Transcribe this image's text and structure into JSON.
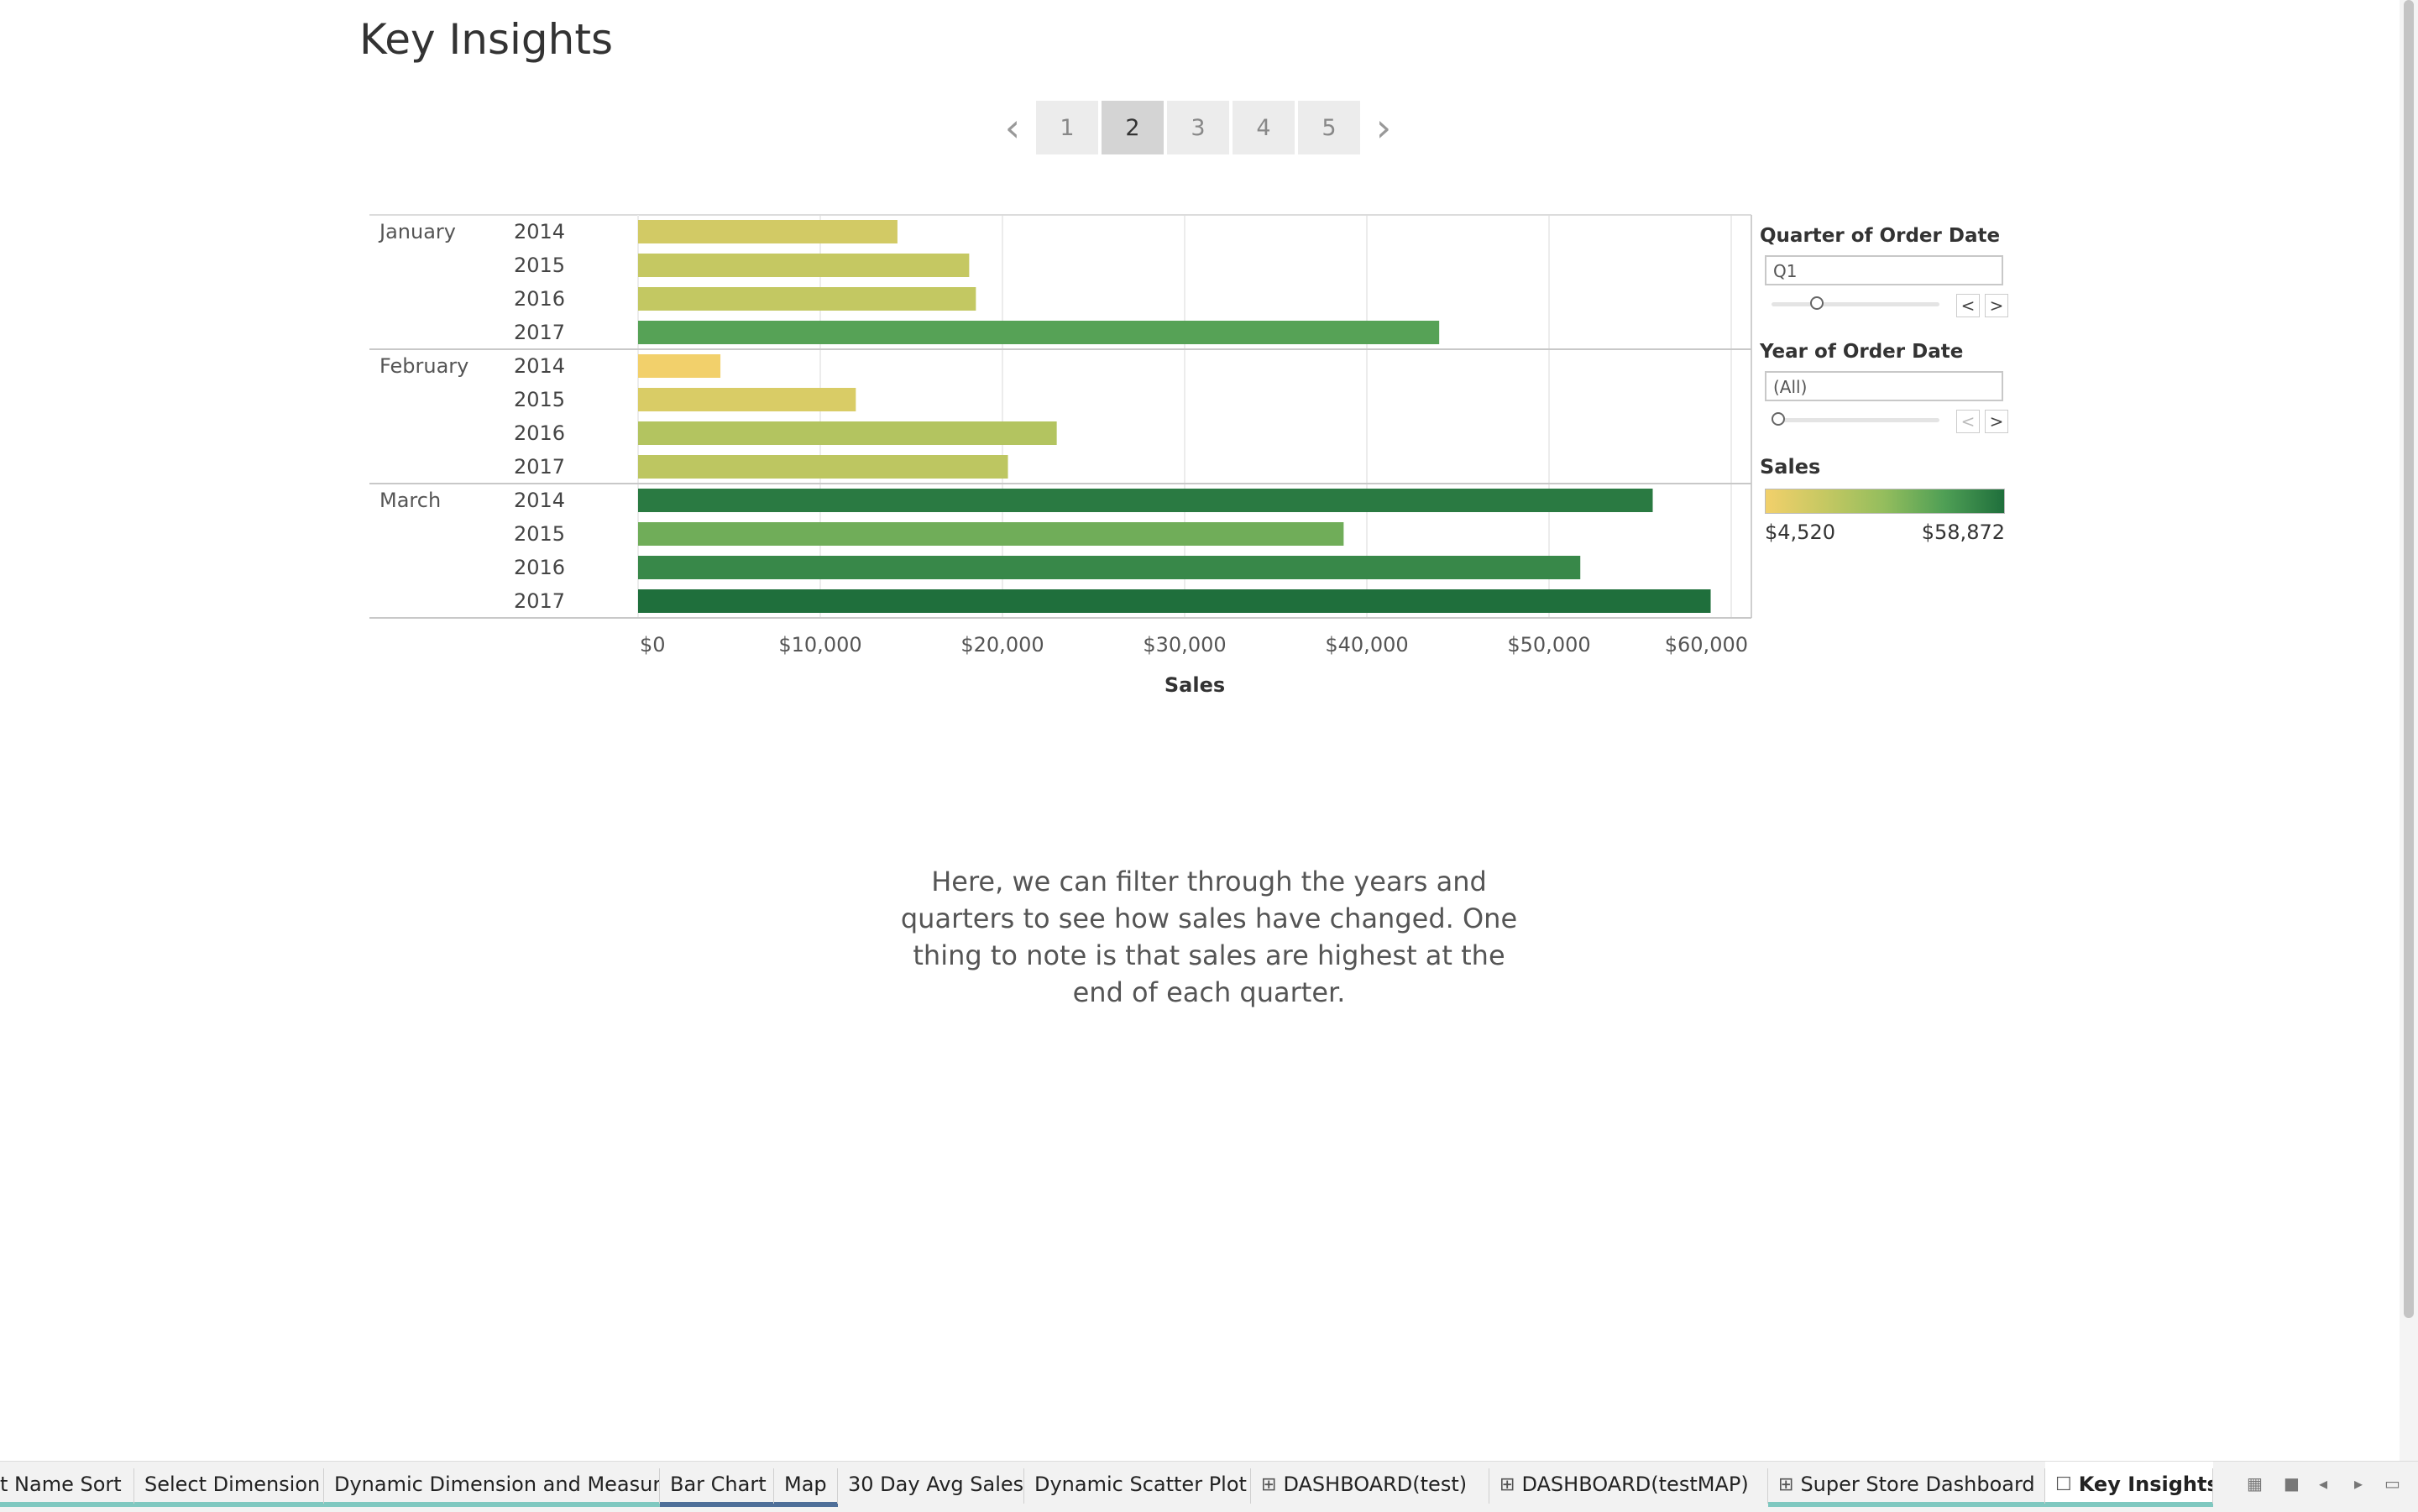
{
  "story": {
    "title": "Key Insights",
    "pages": [
      "1",
      "2",
      "3",
      "4",
      "5"
    ],
    "active_page": "2",
    "prev_icon": "chevron-left-icon",
    "next_icon": "chevron-right-icon",
    "caption": "Here, we can filter through the years and quarters to see how sales have changed. One thing to note is that sales are highest at the end of each quarter."
  },
  "filters": {
    "quarter": {
      "title": "Quarter of Order Date",
      "value": "Q1",
      "prev": "<",
      "next": ">",
      "position_fraction": 0.25
    },
    "year": {
      "title": "Year of Order Date",
      "value": "(All)",
      "prev": "<",
      "next": ">",
      "position_fraction": 0
    }
  },
  "legend": {
    "title": "Sales",
    "min_label": "$4,520",
    "max_label": "$58,872",
    "colors": [
      "#f2d06b",
      "#c5c862",
      "#93bd5d",
      "#4f9f55",
      "#1f6f3c"
    ]
  },
  "chart_data": {
    "type": "bar",
    "orientation": "horizontal",
    "xlabel": "Sales",
    "xlim": [
      0,
      60000
    ],
    "x_ticks": [
      "$0",
      "$10,000",
      "$20,000",
      "$30,000",
      "$40,000",
      "$50,000",
      "$60,000"
    ],
    "x_tick_values": [
      0,
      10000,
      20000,
      30000,
      40000,
      50000,
      60000
    ],
    "grid": true,
    "color_min": 4520,
    "color_max": 58872,
    "groups": [
      {
        "month": "January",
        "rows": [
          {
            "year": "2014",
            "value": 14236
          },
          {
            "year": "2015",
            "value": 18174
          },
          {
            "year": "2016",
            "value": 18542
          },
          {
            "year": "2017",
            "value": 43971
          }
        ]
      },
      {
        "month": "February",
        "rows": [
          {
            "year": "2014",
            "value": 4520
          },
          {
            "year": "2015",
            "value": 11951
          },
          {
            "year": "2016",
            "value": 22979
          },
          {
            "year": "2017",
            "value": 20301
          }
        ]
      },
      {
        "month": "March",
        "rows": [
          {
            "year": "2014",
            "value": 55691
          },
          {
            "year": "2015",
            "value": 38727
          },
          {
            "year": "2016",
            "value": 51716
          },
          {
            "year": "2017",
            "value": 58872
          }
        ]
      }
    ]
  },
  "tabs": [
    {
      "label": "t Name Sort",
      "icon": "",
      "accent": "#7fc8c0"
    },
    {
      "label": "Select Dimension",
      "icon": "",
      "accent": "#7fc8c0"
    },
    {
      "label": "Dynamic Dimension and Measure",
      "icon": "",
      "accent": "#7fc8c0"
    },
    {
      "label": "Bar Chart",
      "icon": "",
      "accent": "#4e6f99"
    },
    {
      "label": "Map",
      "icon": "",
      "accent": "#4e6f99"
    },
    {
      "label": "30 Day Avg Sales",
      "icon": "",
      "accent": ""
    },
    {
      "label": "Dynamic Scatter Plot",
      "icon": "",
      "accent": ""
    },
    {
      "label": "DASHBOARD(test)",
      "icon": "dashboard-icon",
      "accent": ""
    },
    {
      "label": "DASHBOARD(testMAP)",
      "icon": "dashboard-icon",
      "accent": ""
    },
    {
      "label": "Super Store Dashboard",
      "icon": "dashboard-icon",
      "accent": "#7fc8c0"
    },
    {
      "label": "Key Insights",
      "icon": "story-icon",
      "accent": "#7fc8c0",
      "active": true
    }
  ],
  "tab_controls": [
    "show-filmstrip-icon",
    "show-tabs-icon",
    "scroll-left-icon",
    "scroll-right-icon",
    "presentation-icon"
  ]
}
